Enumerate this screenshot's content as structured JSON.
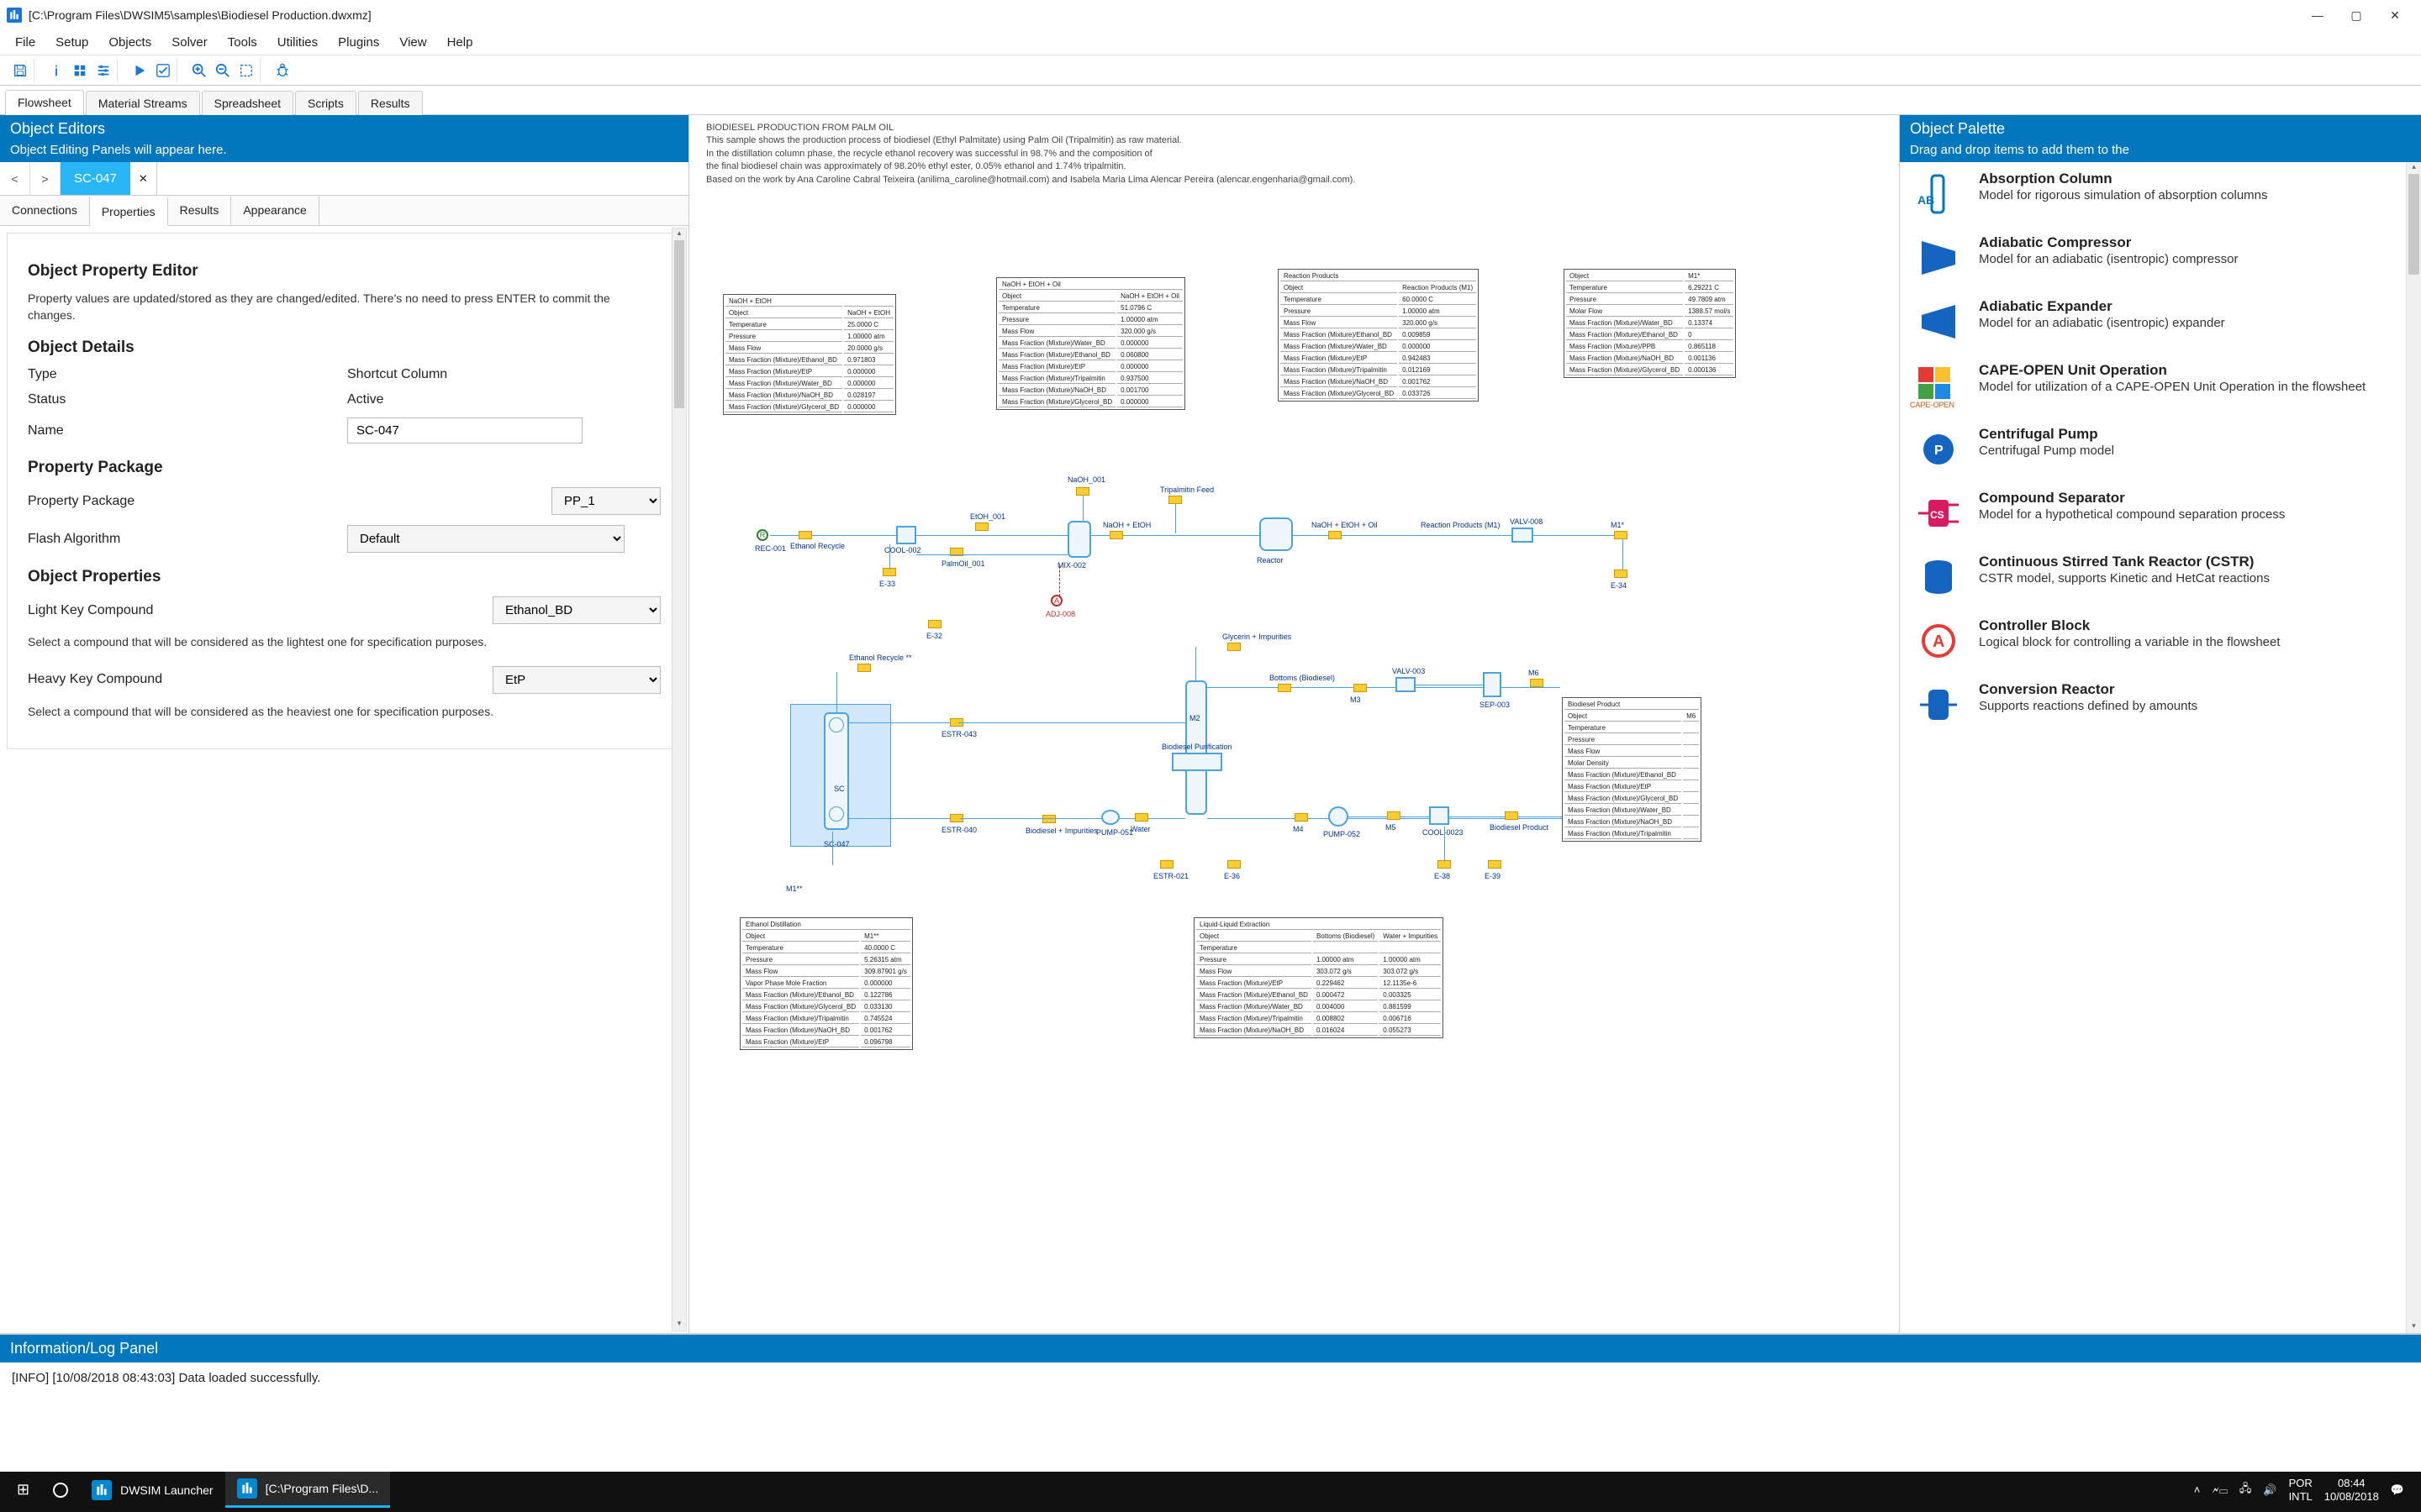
{
  "window": {
    "title": "[C:\\Program Files\\DWSIM5\\samples\\Biodiesel Production.dwxmz]"
  },
  "menu": [
    "File",
    "Setup",
    "Objects",
    "Solver",
    "Tools",
    "Utilities",
    "Plugins",
    "View",
    "Help"
  ],
  "doc_tabs": [
    "Flowsheet",
    "Material Streams",
    "Spreadsheet",
    "Scripts",
    "Results"
  ],
  "doc_active": 0,
  "left_panel": {
    "title": "Object Editors",
    "subtitle": "Object Editing Panels will appear here.",
    "current_object": "SC-047",
    "sub_tabs": [
      "Connections",
      "Properties",
      "Results",
      "Appearance"
    ],
    "sub_active": 1,
    "property_editor": {
      "heading": "Object Property Editor",
      "hint": "Property values are updated/stored as they are changed/edited. There's no need to press ENTER to commit the changes."
    },
    "details": {
      "heading": "Object Details",
      "type_label": "Type",
      "type_value": "Shortcut Column",
      "status_label": "Status",
      "status_value": "Active",
      "name_label": "Name",
      "name_value": "SC-047"
    },
    "pkg": {
      "heading": "Property Package",
      "pkg_label": "Property Package",
      "pkg_value": "PP_1",
      "flash_label": "Flash Algorithm",
      "flash_value": "Default"
    },
    "props": {
      "heading": "Object Properties",
      "light_label": "Light Key Compound",
      "light_value": "Ethanol_BD",
      "light_help": "Select a compound that will be considered as the lightest one for specification purposes.",
      "heavy_label": "Heavy Key Compound",
      "heavy_value": "EtP",
      "heavy_help": "Select a compound that will be considered as the heaviest one for specification purposes."
    }
  },
  "canvas": {
    "desc_title": "BIODIESEL PRODUCTION FROM PALM OIL",
    "desc_lines": [
      "This sample shows the production process of biodiesel (Ethyl Palmitate) using Palm Oil (Tripalmitin) as raw material.",
      "In the distillation column phase, the recycle ethanol recovery was successful in 98.7% and the composition of",
      "the final biodiesel chain was approximately of 98.20% ethyl ester, 0.05% ethanol and 1.74% tripalmitin.",
      "Based on the work by Ana Caroline Cabral Teixeira (anilima_caroline@hotmail.com) and Isabela Maria Lima Alencar Pereira (alencar.engenharia@gmail.com)."
    ]
  },
  "palette": {
    "title": "Object Palette",
    "subtitle": "Drag and drop items to add them to the",
    "items": [
      {
        "name": "Absorption Column",
        "desc": "Model for rigorous simulation of absorption columns",
        "icon_label": "AB",
        "icon_color": "#0277bd",
        "shape": "column"
      },
      {
        "name": "Adiabatic Compressor",
        "desc": "Model for an adiabatic (isentropic) compressor",
        "icon_color": "#1565c0",
        "shape": "triangle-right"
      },
      {
        "name": "Adiabatic Expander",
        "desc": "Model for an adiabatic (isentropic) expander",
        "icon_color": "#1565c0",
        "shape": "triangle-left"
      },
      {
        "name": "CAPE-OPEN Unit Operation",
        "desc": "Model for utilization of a CAPE-OPEN Unit Operation in the flowsheet",
        "icon_label": "CAPE-OPEN",
        "icon_color": "#e65100",
        "shape": "puzzle"
      },
      {
        "name": "Centrifugal Pump",
        "desc": "Centrifugal Pump model",
        "icon_label": "P",
        "icon_color": "#1565c0",
        "shape": "circle"
      },
      {
        "name": "Compound Separator",
        "desc": "Model for a hypothetical compound separation process",
        "icon_label": "CS",
        "icon_color": "#d81b60",
        "shape": "split"
      },
      {
        "name": "Continuous Stirred Tank Reactor (CSTR)",
        "desc": "CSTR model, supports Kinetic and HetCat reactions",
        "icon_color": "#1565c0",
        "shape": "tank"
      },
      {
        "name": "Controller Block",
        "desc": "Logical block for controlling a variable in the flowsheet",
        "icon_label": "A",
        "icon_color": "#e53935",
        "shape": "ring"
      },
      {
        "name": "Conversion Reactor",
        "desc": "Supports reactions defined by amounts",
        "icon_color": "#1565c0",
        "shape": "reactor"
      }
    ]
  },
  "info_panel": {
    "title": "Information/Log Panel",
    "line": "[INFO] [10/08/2018 08:43:03] Data loaded successfully."
  },
  "taskbar": {
    "apps": [
      {
        "label": "DWSIM Launcher"
      },
      {
        "label": "[C:\\Program Files\\D..."
      }
    ],
    "lang_top": "POR",
    "lang_bottom": "INTL",
    "time": "08:44",
    "date": "10/08/2018"
  }
}
